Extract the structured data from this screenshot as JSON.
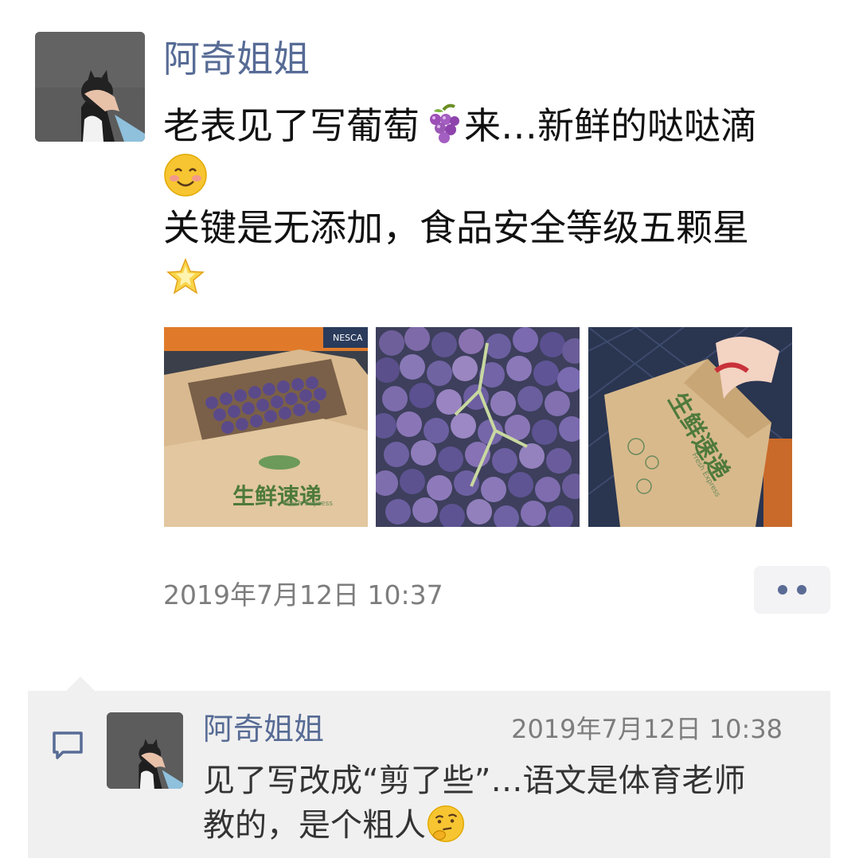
{
  "post": {
    "author": "阿奇姐姐",
    "avatar_icon": "avatar-photo-icon",
    "text_line1_a": "老表见了写葡萄",
    "text_line1_emoji": "grapes-emoji-icon",
    "text_line1_b": "来…新鲜的哒哒滴",
    "text_line2_emoji": "blush-smile-emoji-icon",
    "text_line3": "关键是无添加，食品安全等级五颗星",
    "text_line4_emoji": "glowing-star-emoji-icon",
    "photos": [
      {
        "icon": "grape-box-photo-icon",
        "box_text": "生鲜速递",
        "box_subtext": "Fresh Express",
        "brand_text": "NESCA"
      },
      {
        "icon": "grape-bunch-photo-icon"
      },
      {
        "icon": "carried-box-photo-icon",
        "box_text": "生鲜速递",
        "box_subtext": "Fresh Express"
      }
    ],
    "timestamp": "2019年7月12日 10:37",
    "more_button_icon": "more-dots-icon"
  },
  "comment": {
    "icon": "comment-bubble-icon",
    "author": "阿奇姐姐",
    "timestamp": "2019年7月12日 10:38",
    "text_line1": "见了写改成“剪了些”…语文是体育老师",
    "text_line2": "教的，是个粗人",
    "text_emoji": "thinking-face-emoji-icon"
  },
  "colors": {
    "link_blue": "#576b95",
    "text_dark": "#111111",
    "text_grey": "#7d7d7d",
    "panel_bg": "#f0f0f0"
  }
}
